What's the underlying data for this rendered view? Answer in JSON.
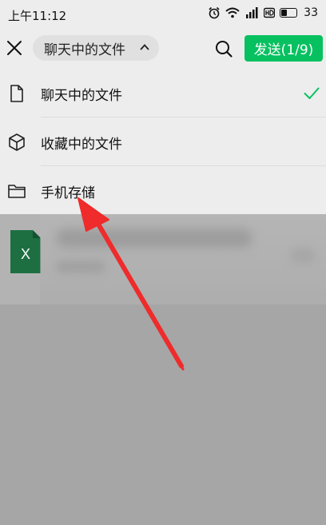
{
  "status_bar": {
    "time": "上午11:12",
    "battery": "33",
    "icons": [
      "alarm-icon",
      "wifi-icon",
      "signal-icon",
      "hd-icon",
      "battery-icon"
    ]
  },
  "toolbar": {
    "dropdown_label": "聊天中的文件",
    "send_label": "发送(1/9)",
    "accent_color": "#07c160"
  },
  "menu": {
    "items": [
      {
        "label": "聊天中的文件",
        "icon": "document-icon",
        "selected": true
      },
      {
        "label": "收藏中的文件",
        "icon": "cube-icon",
        "selected": false
      },
      {
        "label": "手机存储",
        "icon": "folder-icon",
        "selected": false
      }
    ]
  },
  "file_list": {
    "file_icon": "excel-icon",
    "file_icon_letter": "X",
    "file_icon_color": "#1d6f42"
  }
}
